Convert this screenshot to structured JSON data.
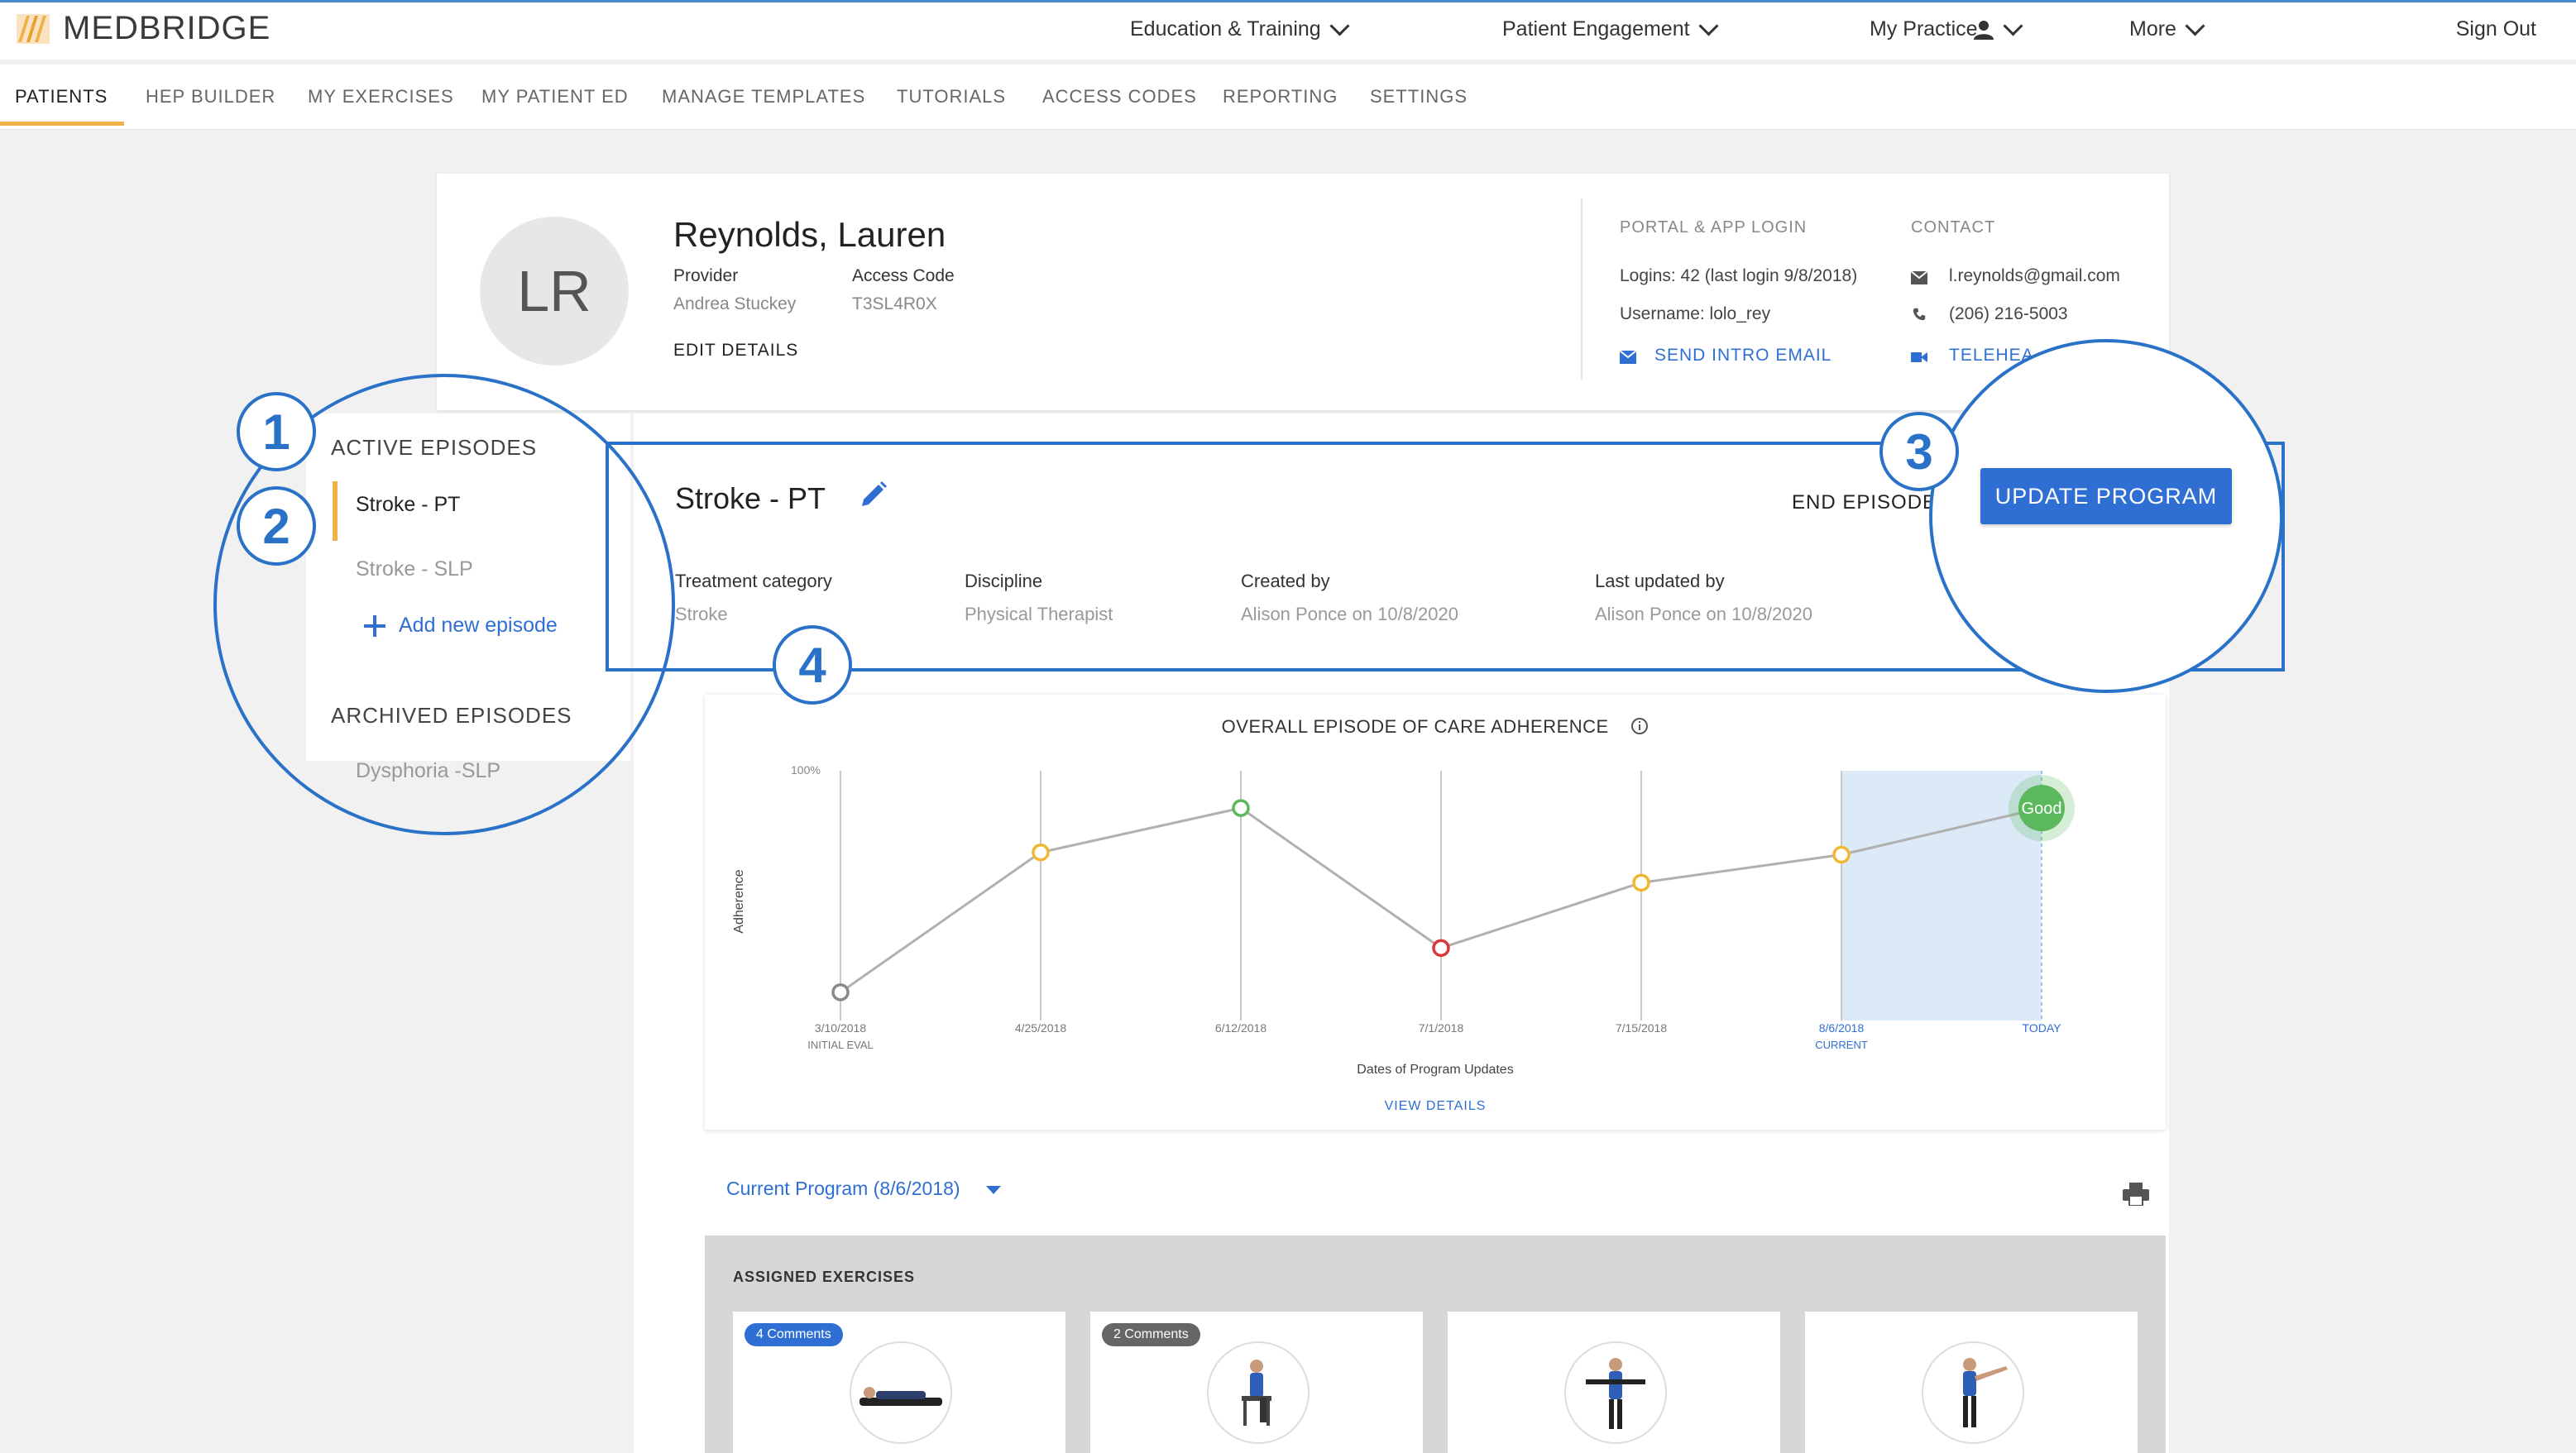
{
  "brand": {
    "name": "MEDBRIDGE"
  },
  "topnav": {
    "education": "Education & Training",
    "engagement": "Patient Engagement",
    "practice": "My Practice",
    "more": "More",
    "signout": "Sign Out"
  },
  "subnav": [
    "PATIENTS",
    "HEP BUILDER",
    "MY EXERCISES",
    "MY PATIENT ED",
    "MANAGE TEMPLATES",
    "TUTORIALS",
    "ACCESS CODES",
    "REPORTING",
    "SETTINGS"
  ],
  "patient": {
    "initials": "LR",
    "name": "Reynolds, Lauren",
    "provider_label": "Provider",
    "provider": "Andrea Stuckey",
    "access_label": "Access Code",
    "access_code": "T3SL4R0X",
    "edit": "EDIT DETAILS",
    "portal_head": "PORTAL & APP LOGIN",
    "logins": "Logins: 42 (last login 9/8/2018)",
    "username": "Username: lolo_rey",
    "send_intro": "SEND INTRO EMAIL",
    "contact_head": "CONTACT",
    "email": "l.reynolds@gmail.com",
    "phone": "(206) 216-5003",
    "telehealth": "TELEHEA"
  },
  "episodes": {
    "active_head": "ACTIVE EPISODES",
    "active": [
      "Stroke - PT",
      "Stroke - SLP"
    ],
    "add": "Add new episode",
    "archived_head": "ARCHIVED EPISODES",
    "archived": [
      "Dysphoria -SLP"
    ]
  },
  "episode": {
    "title": "Stroke - PT",
    "end": "END EPISODE",
    "update": "UPDATE PROGRAM",
    "meta": [
      {
        "label": "Treatment category",
        "value": "Stroke"
      },
      {
        "label": "Discipline",
        "value": "Physical Therapist"
      },
      {
        "label": "Created by",
        "value": "Alison Ponce on 10/8/2020"
      },
      {
        "label": "Last updated by",
        "value": "Alison Ponce on 10/8/2020"
      }
    ]
  },
  "chart_data": {
    "type": "line",
    "title": "OVERALL EPISODE OF CARE ADHERENCE",
    "ylabel": "Adherence",
    "xlabel": "Dates of Program Updates",
    "ytick": "100%",
    "ylim": [
      0,
      100
    ],
    "x": [
      "3/10/2018",
      "4/25/2018",
      "6/12/2018",
      "7/1/2018",
      "7/15/2018",
      "8/6/2018",
      "TODAY"
    ],
    "sublabels": [
      "INITIAL EVAL",
      "",
      "",
      "",
      "",
      "CURRENT",
      ""
    ],
    "values": [
      5,
      65,
      84,
      24,
      52,
      64,
      84
    ],
    "point_colors": [
      "#888888",
      "#f2b632",
      "#5cb85c",
      "#d9363e",
      "#f2b632",
      "#f2b632",
      "#5cb85c"
    ],
    "current_badge": "Good",
    "view_details": "VIEW DETAILS"
  },
  "program": {
    "label": "Current Program (8/6/2018)"
  },
  "assigned": {
    "title": "ASSIGNED EXERCISES",
    "cards": [
      {
        "badge": "4 Comments",
        "badge_color": "#2f6fd3"
      },
      {
        "badge": "2 Comments",
        "badge_color": "#666666"
      },
      {
        "badge": "",
        "badge_color": ""
      },
      {
        "badge": "",
        "badge_color": ""
      }
    ]
  },
  "callouts": [
    "1",
    "2",
    "3",
    "4"
  ]
}
